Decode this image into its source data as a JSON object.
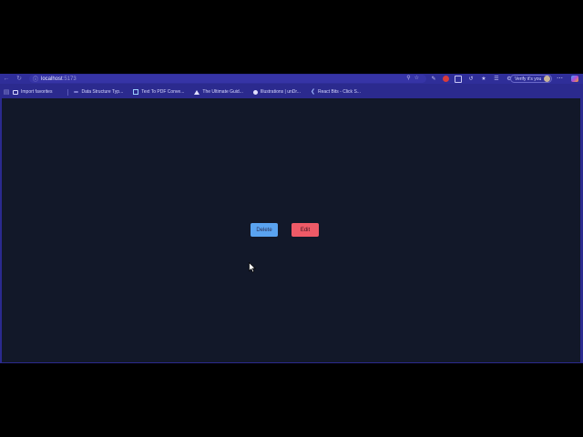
{
  "browser": {
    "address_bar": {
      "host": "localhost",
      "port": ":5173"
    },
    "profile_label": "Verify it's you",
    "toolbar_icons": [
      "search-icon",
      "star-icon",
      "pen-icon",
      "extension-red-icon",
      "box-icon",
      "refresh-icon",
      "puzzle-icon",
      "favorites-icon",
      "wrench-icon"
    ]
  },
  "bookmarks": [
    {
      "label": "Import favorites",
      "icon": "folder-icon"
    },
    {
      "label": "Data Structure Typ...",
      "icon": "site-icon"
    },
    {
      "label": "Text To PDF Conve...",
      "icon": "pdf-icon"
    },
    {
      "label": "The Ultimate Guid...",
      "icon": "triangle-icon"
    },
    {
      "label": "Illustrations | unDr...",
      "icon": "circle-icon"
    },
    {
      "label": "React Bits - Click S...",
      "icon": "react-bits-icon"
    }
  ],
  "page": {
    "delete_label": "Delete",
    "edit_label": "Edit"
  },
  "colors": {
    "browser_frame": "#2b2a8e",
    "page_background": "#121829",
    "delete_button": "#5aa3f0",
    "edit_button": "#ee5a67"
  }
}
